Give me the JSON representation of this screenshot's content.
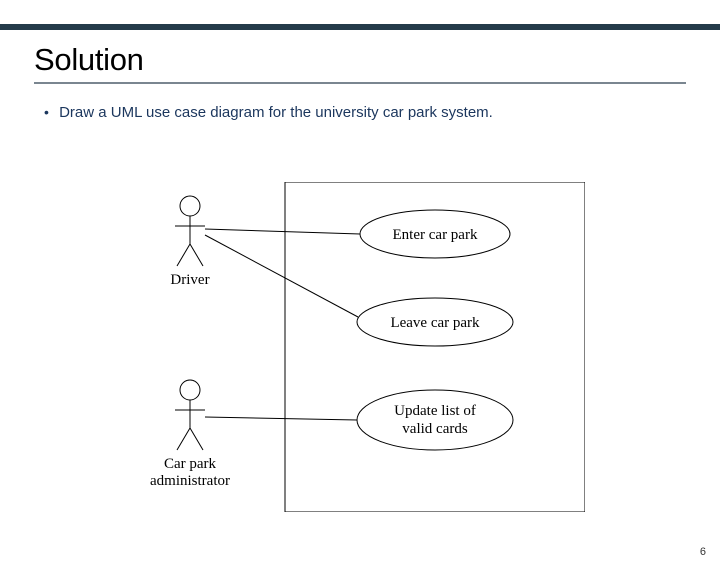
{
  "header": {
    "title": "Solution"
  },
  "bullet": {
    "text": "Draw a UML use case diagram for the university car park system."
  },
  "diagram": {
    "actors": [
      {
        "name": "Driver"
      },
      {
        "name_line1": "Car park",
        "name_line2": "administrator"
      }
    ],
    "usecases": [
      {
        "label": "Enter car park"
      },
      {
        "label": "Leave car park"
      },
      {
        "label_line1": "Update list of",
        "label_line2": "valid cards"
      }
    ]
  },
  "page": {
    "number": "6"
  }
}
